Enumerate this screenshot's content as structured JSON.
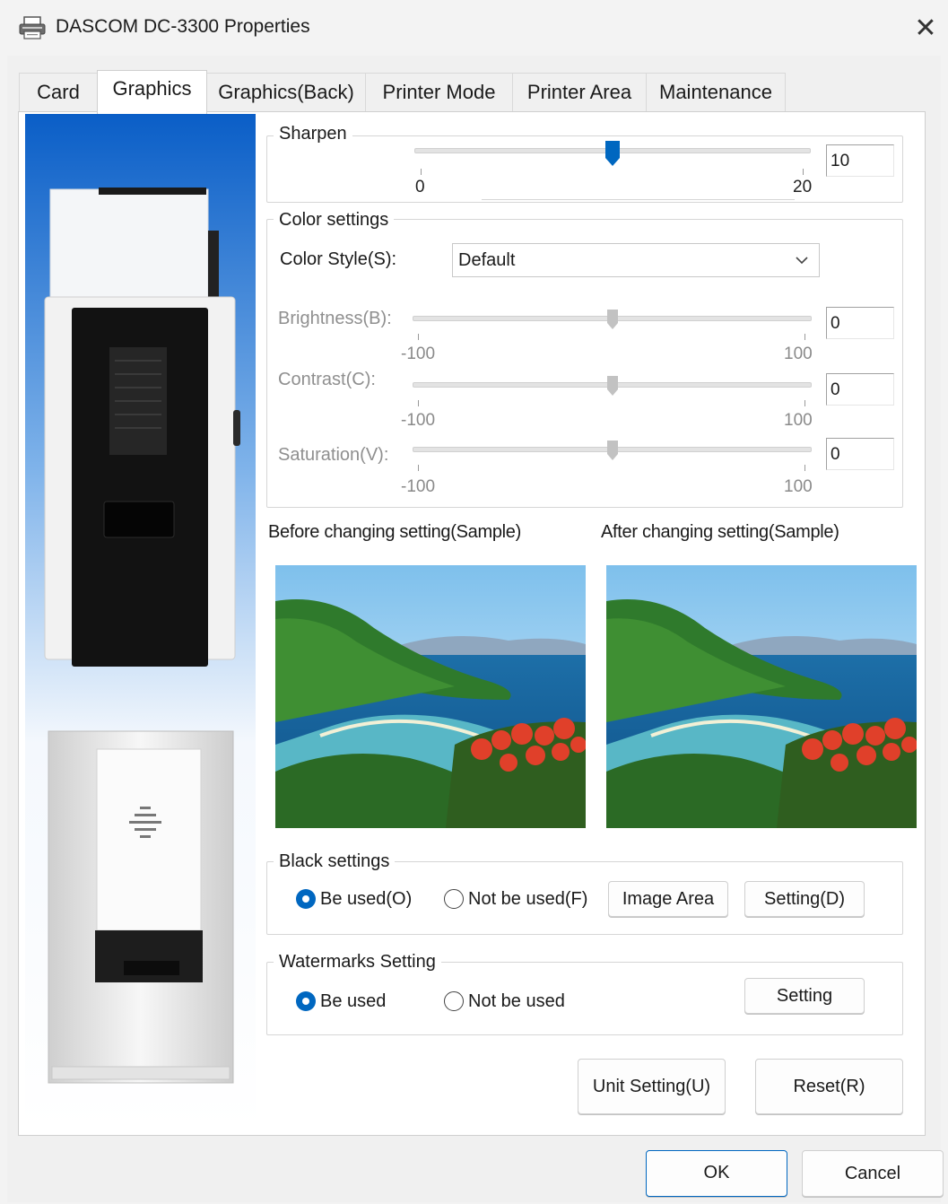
{
  "window": {
    "title": "DASCOM DC-3300 Properties",
    "close_glyph": "✕"
  },
  "tabs": [
    {
      "label": "Card"
    },
    {
      "label": "Graphics"
    },
    {
      "label": "Graphics(Back)"
    },
    {
      "label": "Printer Mode"
    },
    {
      "label": "Printer Area"
    },
    {
      "label": "Maintenance"
    }
  ],
  "active_tab": "Graphics",
  "sharpen": {
    "title": "Sharpen",
    "min": "0",
    "max": "20",
    "value": "10"
  },
  "color_settings": {
    "title": "Color settings",
    "style_label": "Color Style(S):",
    "style_value": "Default",
    "brightness": {
      "label": "Brightness(B):",
      "min": "-100",
      "max": "100",
      "value": "0"
    },
    "contrast": {
      "label": "Contrast(C):",
      "min": "-100",
      "max": "100",
      "value": "0"
    },
    "saturation": {
      "label": "Saturation(V):",
      "min": "-100",
      "max": "100",
      "value": "0"
    }
  },
  "samples": {
    "before_caption": "Before changing setting(Sample)",
    "after_caption": "After changing setting(Sample)"
  },
  "black_settings": {
    "title": "Black settings",
    "option_used": "Be used(O)",
    "option_not_used": "Not be used(F)",
    "selected": "Be used(O)",
    "image_area_button": "Image Area",
    "setting_button": "Setting(D)"
  },
  "watermarks": {
    "title": "Watermarks Setting",
    "option_used": "Be used",
    "option_not_used": "Not be used",
    "selected": "Be used",
    "setting_button": "Setting"
  },
  "actions": {
    "unit_setting": "Unit Setting(U)",
    "reset": "Reset(R)"
  },
  "footer": {
    "ok": "OK",
    "cancel": "Cancel"
  },
  "colors": {
    "accent": "#0067c0",
    "side_gradient_top": "#0a5ec7",
    "side_gradient_bottom": "#ffffff"
  }
}
